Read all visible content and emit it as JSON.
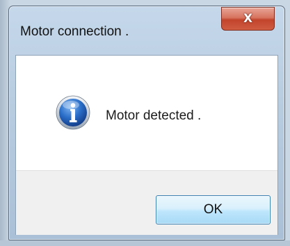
{
  "dialog": {
    "title": "Motor connection .",
    "close_glyph": "X",
    "message": "Motor detected .",
    "icon": "info-icon",
    "ok_label": "OK"
  },
  "colors": {
    "titlebar": "#b9cde1",
    "close_button": "#c2442b",
    "ok_button": "#bee6fd",
    "info_icon": "#1f5fb8"
  }
}
